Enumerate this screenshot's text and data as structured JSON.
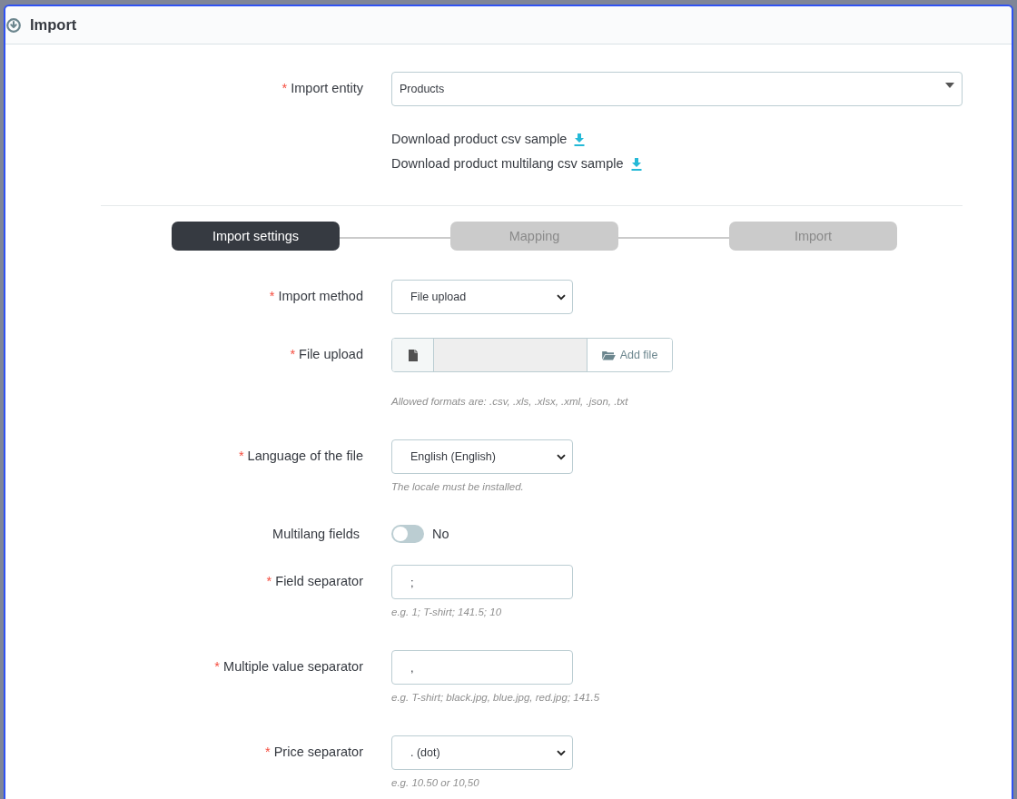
{
  "header": {
    "title": "Import"
  },
  "entity": {
    "required_mark": "*",
    "label": "Import entity",
    "value": "Products"
  },
  "downloads": [
    {
      "label": "Download product csv sample"
    },
    {
      "label": "Download product multilang csv sample"
    }
  ],
  "steps": [
    {
      "label": "Import settings",
      "selected": true
    },
    {
      "label": "Mapping",
      "selected": false
    },
    {
      "label": "Import",
      "selected": false
    }
  ],
  "fields": [
    {
      "kind": "select",
      "required_mark": "*",
      "label": "Import method",
      "value": "File upload"
    },
    {
      "kind": "file",
      "required_mark": "*",
      "label": "File upload",
      "button": "Add file",
      "help": "Allowed formats are: .csv, .xls, .xlsx, .xml, .json, .txt"
    },
    {
      "kind": "select",
      "required_mark": "*",
      "label": "Language of the file",
      "value": "English (English)",
      "help": "The locale must be installed."
    },
    {
      "kind": "switch",
      "label": "Multilang fields",
      "on": false,
      "state_label": "No"
    },
    {
      "kind": "text",
      "required_mark": "*",
      "label": "Field separator",
      "value": ";",
      "help": "e.g. 1; T-shirt; 141.5; 10"
    },
    {
      "kind": "text",
      "required_mark": "*",
      "label": "Multiple value separator",
      "value": ",",
      "help": "e.g. T-shirt; black.jpg, blue.jpg, red.jpg; 141.5"
    },
    {
      "kind": "select",
      "required_mark": "*",
      "label": "Price separator",
      "value": ". (dot)",
      "help": "e.g. 10.50 or 10,50"
    }
  ]
}
